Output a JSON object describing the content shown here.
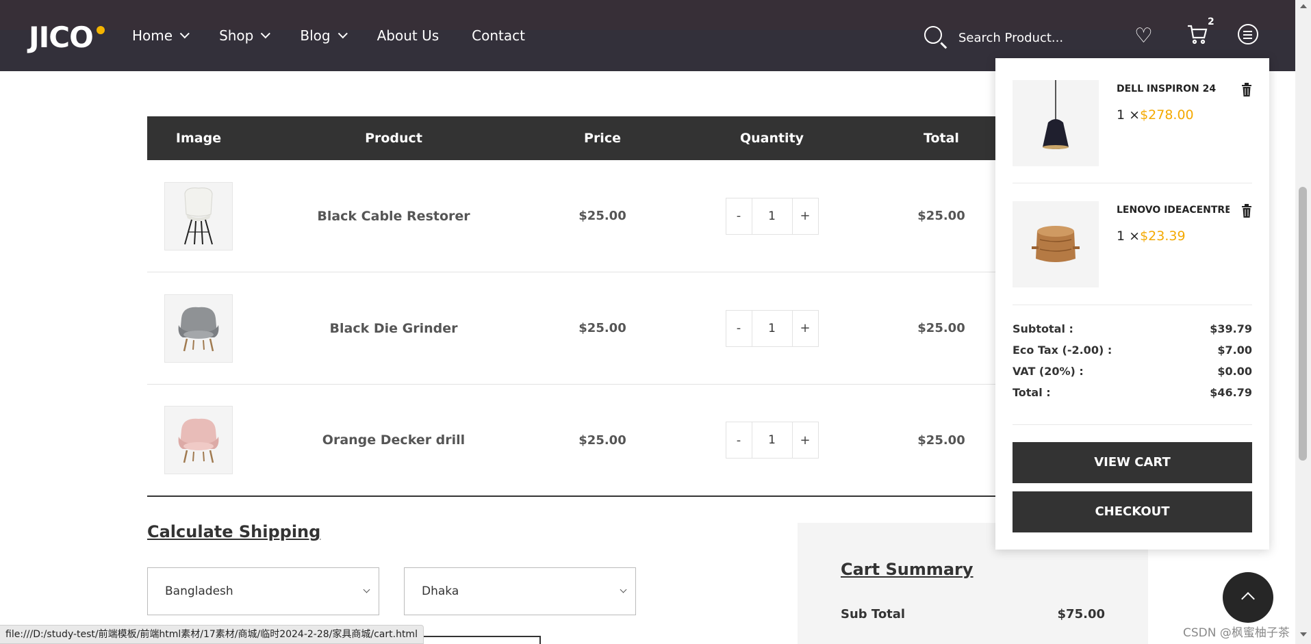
{
  "header": {
    "logo": "JICO",
    "nav": [
      {
        "label": "Home",
        "has_dropdown": true
      },
      {
        "label": "Shop",
        "has_dropdown": true
      },
      {
        "label": "Blog",
        "has_dropdown": true
      },
      {
        "label": "About Us",
        "has_dropdown": false
      },
      {
        "label": "Contact",
        "has_dropdown": false
      }
    ],
    "search_placeholder": "Search Product...",
    "cart_count": "2",
    "icons": [
      "search-icon",
      "heart-icon",
      "cart-icon",
      "menu-icon"
    ]
  },
  "cart_table": {
    "headers": [
      "Image",
      "Product",
      "Price",
      "Quantity",
      "Total"
    ],
    "rows": [
      {
        "product": "Black Cable Restorer",
        "price": "$25.00",
        "qty": "1",
        "total": "$25.00",
        "minus": "-",
        "plus": "+"
      },
      {
        "product": "Black Die Grinder",
        "price": "$25.00",
        "qty": "1",
        "total": "$25.00",
        "minus": "-",
        "plus": "+"
      },
      {
        "product": "Orange Decker drill",
        "price": "$25.00",
        "qty": "1",
        "total": "$25.00",
        "minus": "-",
        "plus": "+"
      }
    ]
  },
  "shipping": {
    "title": "Calculate Shipping",
    "country": "Bangladesh",
    "city": "Dhaka"
  },
  "summary": {
    "title": "Cart Summary",
    "sub_total_label": "Sub Total",
    "sub_total_value": "$75.00"
  },
  "minicart": {
    "items": [
      {
        "name": "DELL INSPIRON 24",
        "qty": "1 ×",
        "price": "$278.00"
      },
      {
        "name": "LENOVO IDEACENTRE",
        "qty": "1 ×",
        "price": "$23.39"
      }
    ],
    "totals": [
      {
        "label": "Subtotal :",
        "value": "$39.79"
      },
      {
        "label": "Eco Tax (-2.00) :",
        "value": "$7.00"
      },
      {
        "label": "VAT (20%) :",
        "value": "$0.00"
      },
      {
        "label": "Total :",
        "value": "$46.79"
      }
    ],
    "view_cart": "VIEW CART",
    "checkout": "CHECKOUT"
  },
  "statusbar": "file:///D:/study-test/前端模板/前端html素材/17素材/商城/临时2024-2-28/家具商城/cart.html",
  "watermark": "CSDN @枫蜜柚子茶",
  "colors": {
    "accent": "#f4a900",
    "header_bg": "#33303a",
    "dark": "#333333"
  }
}
